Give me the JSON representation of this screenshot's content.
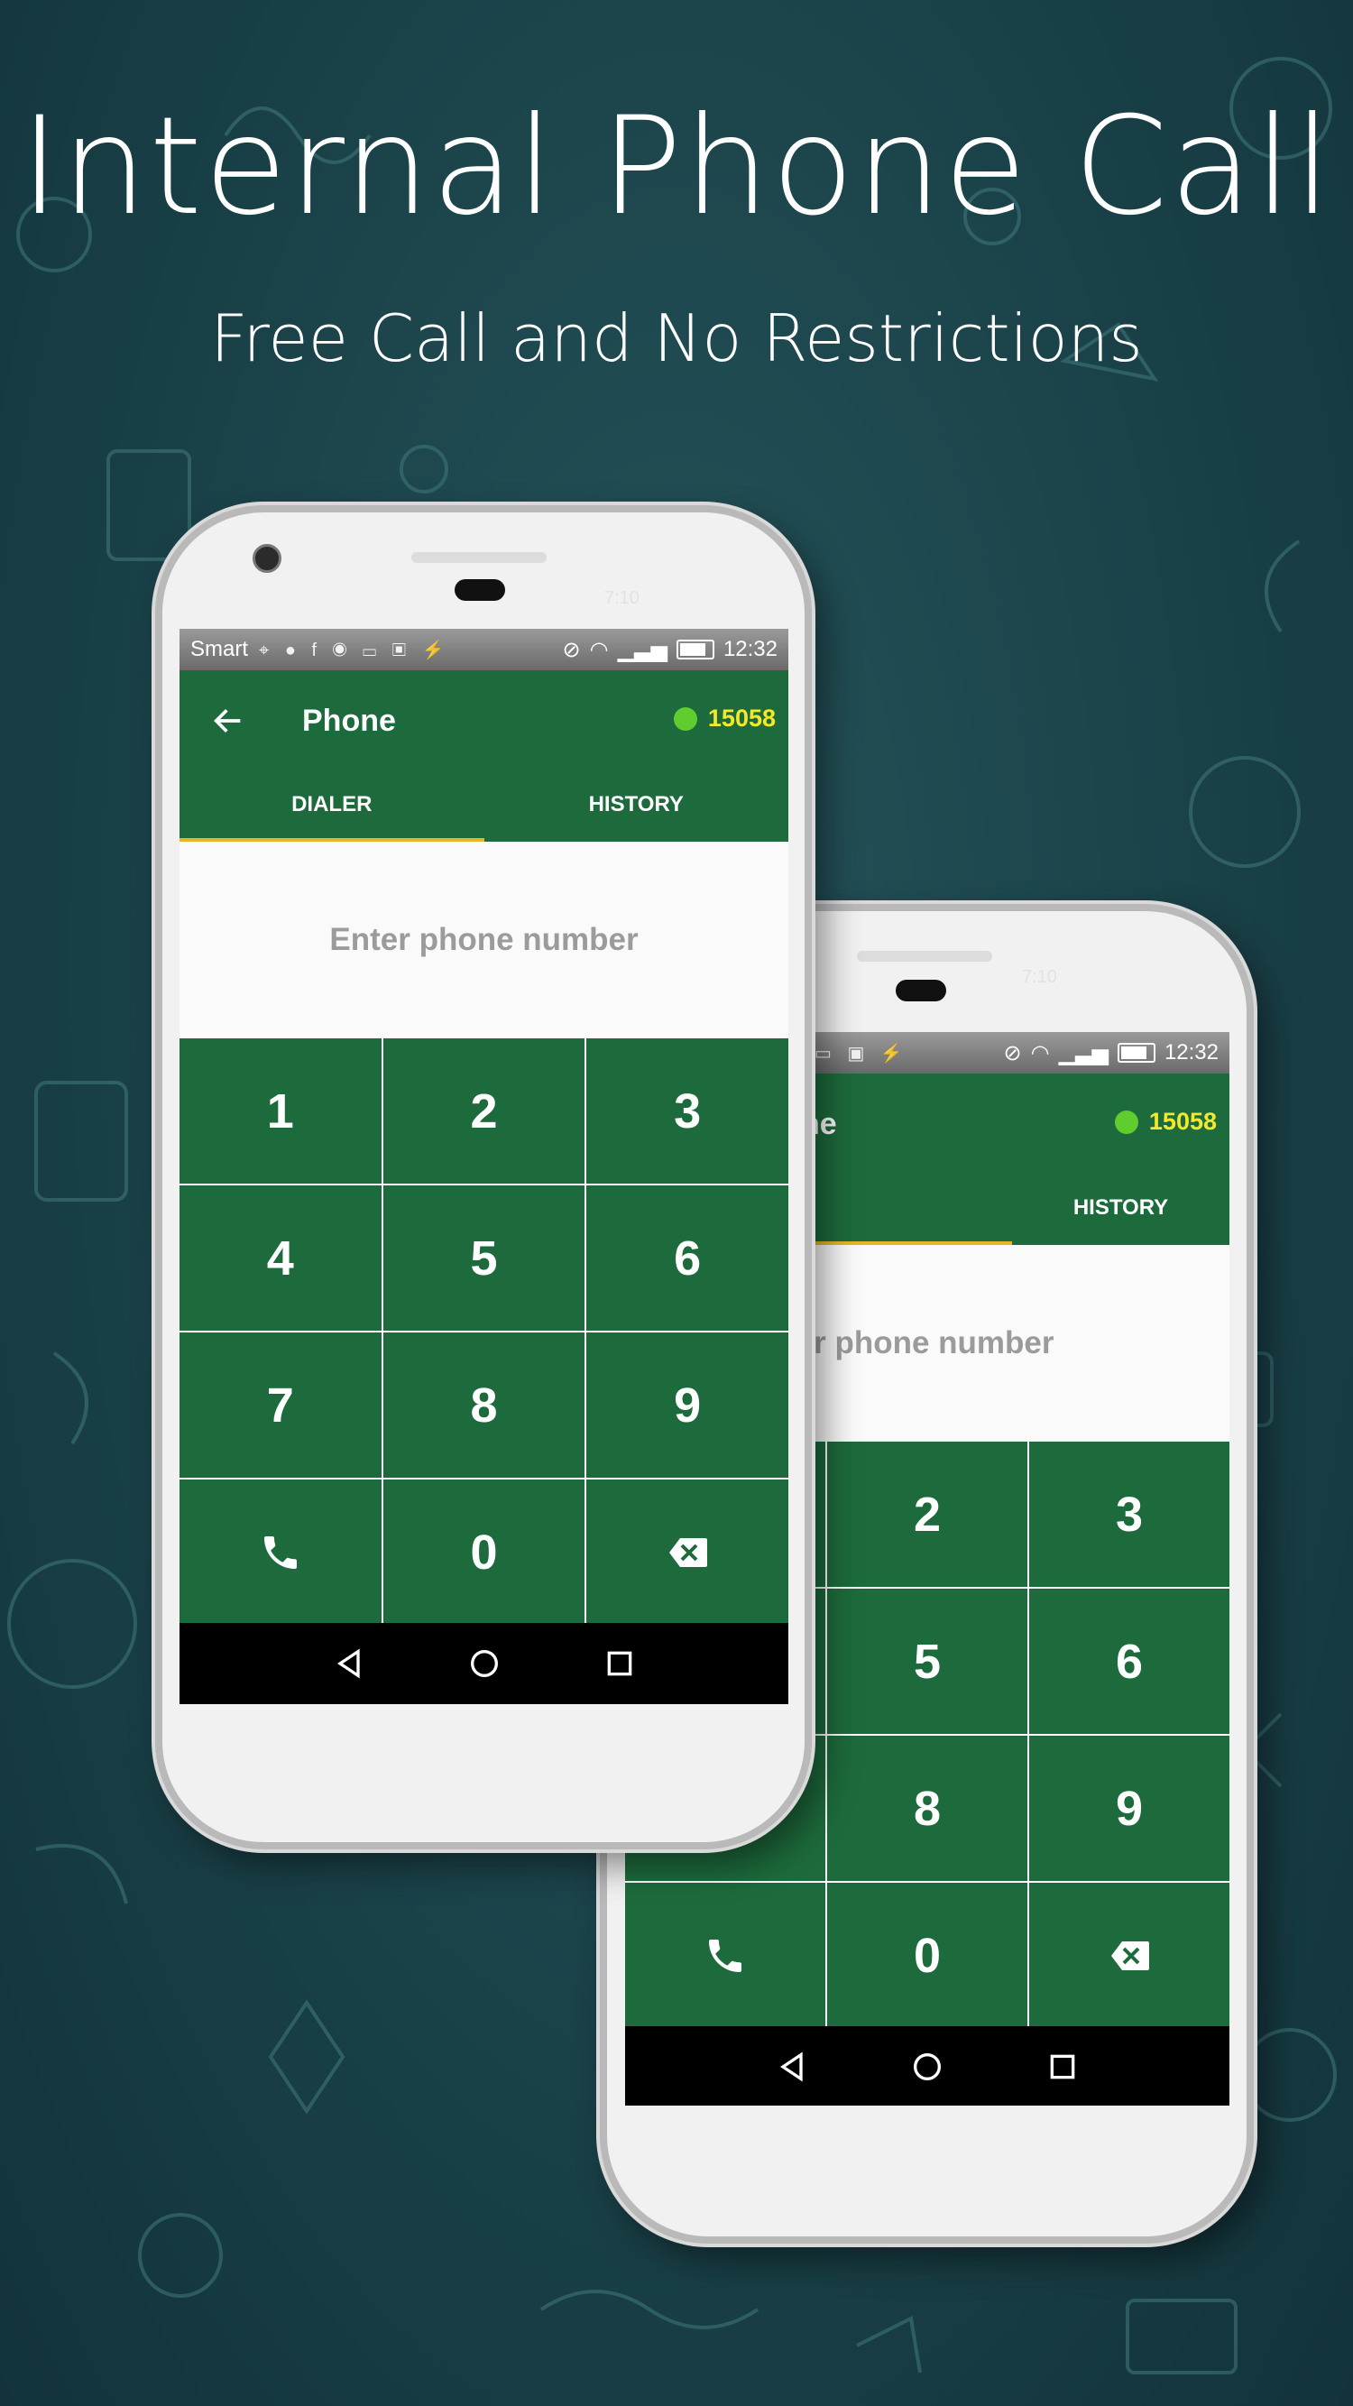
{
  "promo": {
    "headline": "Internal Phone Call",
    "subheadline": "Free Call and No Restrictions"
  },
  "front_phone": {
    "hardware_time": "7:10",
    "status_bar": {
      "carrier": "Smart",
      "time": "12:32"
    },
    "app_bar": {
      "title": "Phone",
      "credit": "15058"
    },
    "tabs": [
      {
        "label": "DIALER",
        "active": true
      },
      {
        "label": "HISTORY",
        "active": false
      }
    ],
    "number_input_placeholder": "Enter phone number",
    "keys": [
      "1",
      "2",
      "3",
      "4",
      "5",
      "6",
      "7",
      "8",
      "9",
      "0"
    ]
  },
  "back_phone": {
    "hardware_time": "7:10",
    "status_bar": {
      "time": "12:32"
    },
    "app_bar": {
      "title_fragment": "ne",
      "credit": "15058"
    },
    "tabs": [
      {
        "label": "R",
        "active": true
      },
      {
        "label": "HISTORY",
        "active": false
      }
    ],
    "number_input_fragment": "ter phone number",
    "keys": [
      "2",
      "3",
      "5",
      "6",
      "8",
      "9",
      "0"
    ]
  },
  "icons": {
    "back": "arrow-left-icon",
    "call": "phone-icon",
    "delete": "backspace-icon",
    "nav_back": "triangle-back-icon",
    "nav_home": "circle-home-icon",
    "nav_recents": "square-recents-icon"
  },
  "colors": {
    "background": "#1a4148",
    "app_green": "#1d6b3c",
    "credit_yellow": "#f3e82a",
    "online_dot": "#5fcd2e",
    "tab_indicator": "#e5b728"
  }
}
